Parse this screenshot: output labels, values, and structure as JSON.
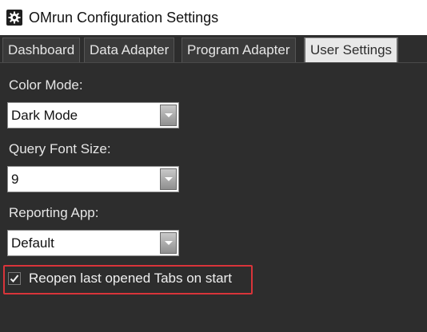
{
  "window": {
    "title": "OMrun Configuration Settings",
    "icon": "gear-icon"
  },
  "tabs": [
    {
      "label": "Dashboard",
      "active": false
    },
    {
      "label": "Data Adapter",
      "active": false
    },
    {
      "label": "Program Adapter",
      "active": false
    },
    {
      "label": "User Settings",
      "active": true
    }
  ],
  "settings": {
    "color_mode": {
      "label": "Color Mode:",
      "value": "Dark Mode"
    },
    "query_font_size": {
      "label": "Query Font Size:",
      "value": "9"
    },
    "reporting_app": {
      "label": "Reporting App:",
      "value": "Default"
    },
    "reopen_tabs": {
      "label": "Reopen last opened Tabs on start",
      "checked": true
    }
  },
  "colors": {
    "background": "#2d2d2d",
    "highlight_border": "#d9343a",
    "active_tab": "#e8e8e8"
  }
}
